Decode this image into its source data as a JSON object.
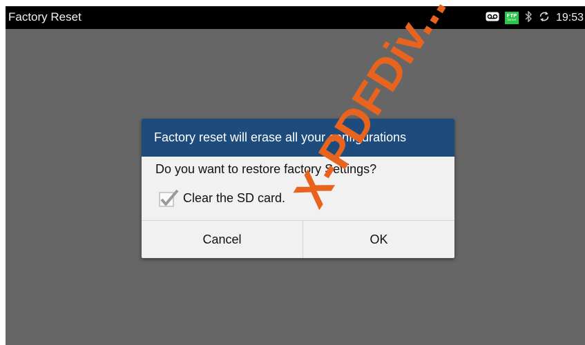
{
  "statusbar": {
    "title": "Factory Reset",
    "time": "19:53",
    "ftp_label": "FTP",
    "ftp_sub": "Server",
    "icons": [
      "voicemail-icon",
      "ftp-icon",
      "bluetooth-icon",
      "sync-icon"
    ]
  },
  "dialog": {
    "title": "Factory reset will erase all your configurations",
    "message": "Do you want to restore factory Settings?",
    "checkbox_label": "Clear the SD card.",
    "checkbox_checked": true,
    "cancel_label": "Cancel",
    "ok_label": "OK"
  },
  "watermark": {
    "text": "X-PDFDiv...",
    "color": "#e8641e"
  },
  "colors": {
    "header": "#1c4b7c",
    "background": "#666666",
    "dialog": "#f1f1f1",
    "statusbar": "#000000",
    "ftp": "#27c84a"
  }
}
